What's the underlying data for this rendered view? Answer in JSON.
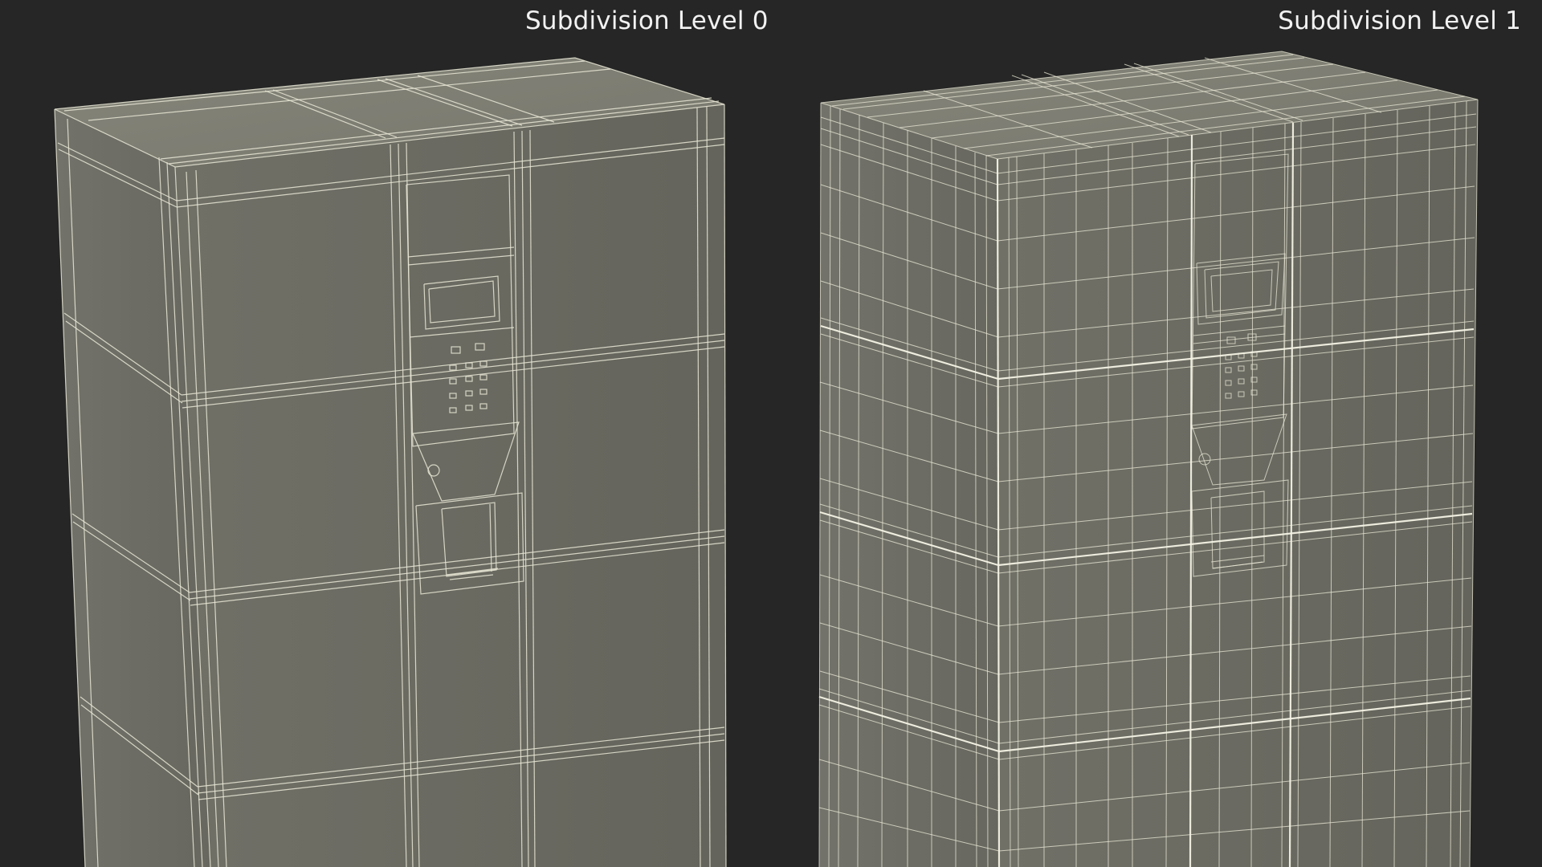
{
  "labels": {
    "left": "Subdivision Level 0",
    "right": "Subdivision Level 1"
  },
  "colors": {
    "background": "#262626",
    "wire": "#e9e8d6",
    "top_face": "#7b7b70",
    "left_face": "#6f6f65",
    "front_face": "#6a6a61",
    "label_text": "#f2f2f2"
  }
}
